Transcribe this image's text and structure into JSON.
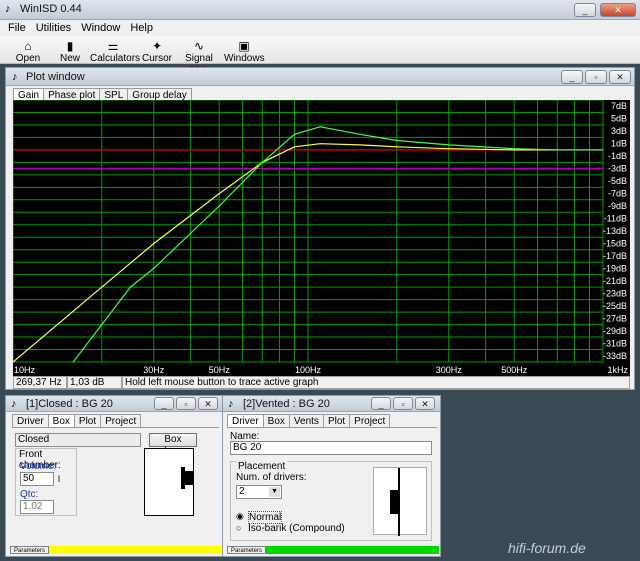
{
  "app": {
    "title": "WinISD 0.44"
  },
  "menu": [
    "File",
    "Utilities",
    "Window",
    "Help"
  ],
  "toolbar": [
    {
      "label": "Open",
      "icon": "open-folder-icon",
      "glyph": "⌂"
    },
    {
      "label": "New",
      "icon": "new-file-icon",
      "glyph": "▮"
    },
    {
      "label": "Calculators",
      "icon": "calculator-icon",
      "glyph": "⚌"
    },
    {
      "label": "Cursor",
      "icon": "cursor-icon",
      "glyph": "✦"
    },
    {
      "label": "Signal gen.",
      "icon": "signal-generator-icon",
      "glyph": "∿"
    },
    {
      "label": "Windows",
      "icon": "windows-icon",
      "glyph": "▣"
    }
  ],
  "plot": {
    "title": "Plot window",
    "tabs": [
      "Gain",
      "Phase plot",
      "SPL",
      "Group delay"
    ],
    "status": {
      "frequency": "269,37 Hz",
      "gain": "1,03 dB",
      "hint": "Hold left mouse button to trace active graph"
    }
  },
  "chart_data": {
    "type": "line",
    "xscale": "log",
    "xlim": [
      10,
      1000
    ],
    "ylim": [
      -34,
      8
    ],
    "grid": true,
    "background": "#000000",
    "grid_color": "#00a000",
    "xticks": [
      "10Hz",
      "30Hz",
      "50Hz",
      "100Hz",
      "300Hz",
      "500Hz",
      "1kHz"
    ],
    "yticks": [
      "7dB",
      "5dB",
      "3dB",
      "1dB",
      "-1dB",
      "-3dB",
      "-5dB",
      "-7dB",
      "-9dB",
      "-11dB",
      "-13dB",
      "-15dB",
      "-17dB",
      "-19dB",
      "-21dB",
      "-23dB",
      "-25dB",
      "-27dB",
      "-29dB",
      "-31dB",
      "-33dB"
    ],
    "series": [
      {
        "color": "#ffff40",
        "x": [
          10,
          20,
          30,
          50,
          70,
          90,
          110,
          150,
          200,
          300,
          500,
          700
        ],
        "y": [
          -34,
          -22,
          -15,
          -7,
          -2,
          0.5,
          1,
          0.8,
          0.5,
          0.2,
          0,
          0
        ]
      },
      {
        "color": "#40ff40",
        "x": [
          16,
          25,
          30,
          50,
          70,
          90,
          110,
          150,
          200,
          300,
          500,
          700,
          1000
        ],
        "y": [
          -34,
          -22,
          -19,
          -9,
          -2,
          2.5,
          3.7,
          2.5,
          1.5,
          0.8,
          0.2,
          0,
          0
        ]
      }
    ],
    "reference_lines": [
      {
        "y": 0,
        "color": "#c00000"
      },
      {
        "y": -3,
        "color": "#b000b0"
      }
    ]
  },
  "closed": {
    "title": "[1]Closed : BG 20",
    "tabs": [
      "Driver",
      "Box",
      "Plot",
      "Project"
    ],
    "box_type": "Closed",
    "box_shape_button": "Box shape",
    "front_chamber": "Front chamber:",
    "volume_label": "Volume:",
    "volume_value": "50",
    "volume_unit": "l",
    "qtc_label": "Qtc:",
    "qtc_value": "1,02",
    "footer": "Parameters",
    "footer_color": "#ffff00"
  },
  "vented": {
    "title": "[2]Vented : BG 20",
    "tabs": [
      "Driver",
      "Box",
      "Vents",
      "Plot",
      "Project"
    ],
    "name_label": "Name:",
    "name_value": "BG 20",
    "placement_label": "Placement",
    "num_drivers_label": "Num. of drivers:",
    "num_drivers_value": "2",
    "normal_label": "Normal",
    "isobarik_label": "Iso-barik (Compound)",
    "footer": "Parameters",
    "footer_color": "#00d800"
  },
  "watermark": "hifi-forum.de"
}
